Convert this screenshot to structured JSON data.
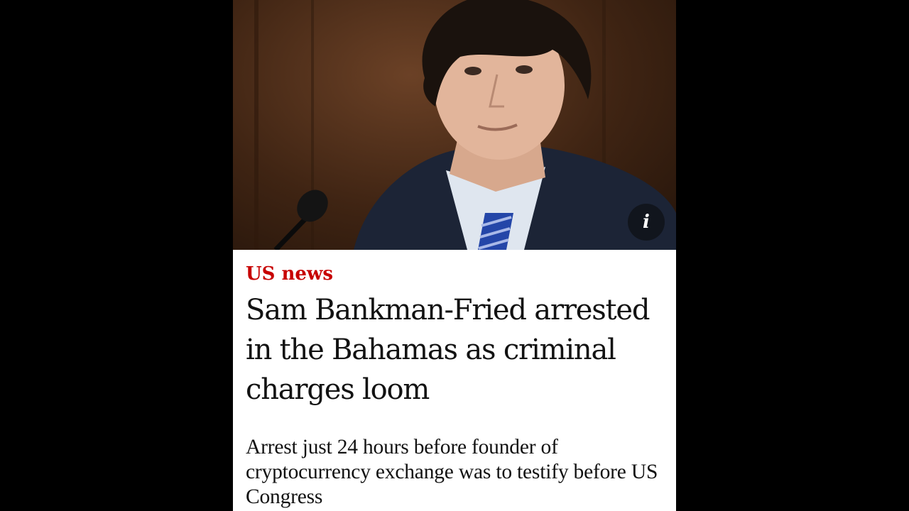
{
  "article": {
    "section": "US news",
    "headline": "Sam Bankman-Fried arrested in the Bahamas as criminal charges loom",
    "standfirst": "Arrest just 24 hours before founder of cryptocurrency exchange was to testify before US Congress"
  },
  "photo": {
    "info_icon": "info-icon",
    "info_glyph": "i"
  },
  "colors": {
    "section_accent": "#c70000",
    "text": "#121212",
    "page_bg": "#000000",
    "card_bg": "#ffffff"
  }
}
